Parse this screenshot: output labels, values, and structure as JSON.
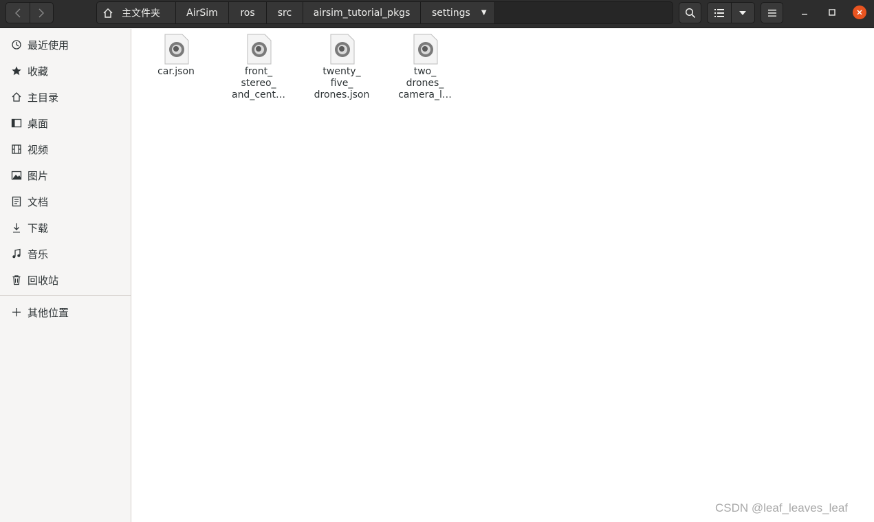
{
  "header": {
    "nav_back_icon": "chevron-left-icon",
    "nav_forward_icon": "chevron-right-icon",
    "breadcrumb": [
      {
        "label": "主文件夹",
        "icon": "home-icon"
      },
      {
        "label": "AirSim"
      },
      {
        "label": "ros"
      },
      {
        "label": "src"
      },
      {
        "label": "airsim_tutorial_pkgs"
      },
      {
        "label": "settings"
      }
    ],
    "search_icon": "search-icon",
    "view_icon": "list-view-icon",
    "view_menu_icon": "chevron-down-icon",
    "menu_icon": "hamburger-icon"
  },
  "sidebar": {
    "items": [
      {
        "label": "最近使用",
        "icon": "recent-icon"
      },
      {
        "label": "收藏",
        "icon": "star-icon"
      },
      {
        "label": "主目录",
        "icon": "home-icon"
      },
      {
        "label": "桌面",
        "icon": "desktop-icon"
      },
      {
        "label": "视频",
        "icon": "video-icon"
      },
      {
        "label": "图片",
        "icon": "picture-icon"
      },
      {
        "label": "文档",
        "icon": "document-icon"
      },
      {
        "label": "下载",
        "icon": "download-icon"
      },
      {
        "label": "音乐",
        "icon": "music-icon"
      },
      {
        "label": "回收站",
        "icon": "trash-icon"
      }
    ],
    "other_locations": {
      "label": "其他位置",
      "icon": "plus-icon"
    }
  },
  "files": [
    {
      "name": "car.json"
    },
    {
      "name": "front_\nstereo_\nand_cent…"
    },
    {
      "name": "twenty_\nfive_\ndrones.json"
    },
    {
      "name": "two_\ndrones_\ncamera_l…"
    }
  ],
  "watermark": "CSDN @leaf_leaves_leaf",
  "colors": {
    "close_button": "#e95420",
    "header_bg": "#2d2d2d",
    "sidebar_bg": "#f6f5f4"
  }
}
